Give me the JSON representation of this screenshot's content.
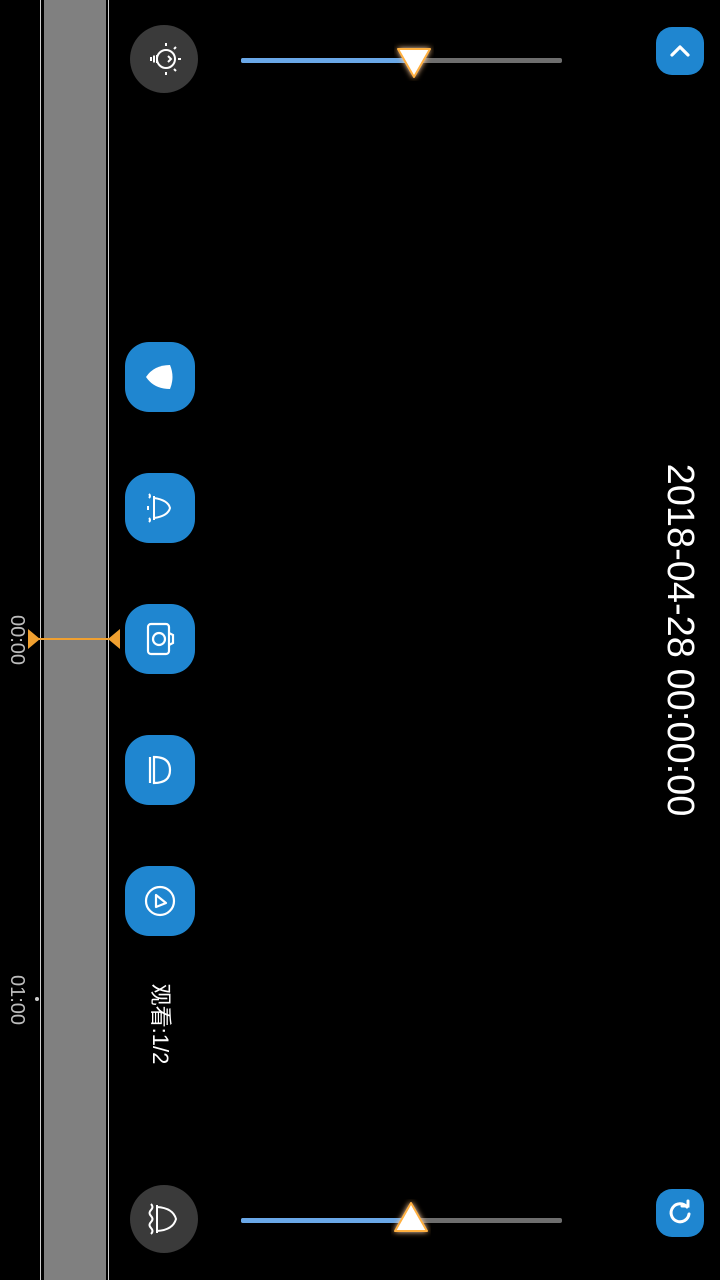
{
  "timeline": {
    "labels": [
      "00:00",
      "01:00"
    ]
  },
  "datetime": "2018-04-28 00:00:00",
  "view_count": "观看:1/2",
  "brightness_slider": {
    "value_fraction": 0.54
  },
  "volume_slider": {
    "value_fraction": 0.53
  },
  "icons": {
    "brightness": "lightbulb-icon",
    "volume": "bell-icon",
    "collapse": "chevron-up-icon",
    "refresh": "refresh-icon",
    "actions": [
      "shield-icon",
      "alarm-icon",
      "camera-icon",
      "light-icon",
      "playback-icon"
    ]
  },
  "colors": {
    "accent": "#1f86d0",
    "playhead": "#f0a030",
    "slider_fill": "#6aa8e8"
  }
}
